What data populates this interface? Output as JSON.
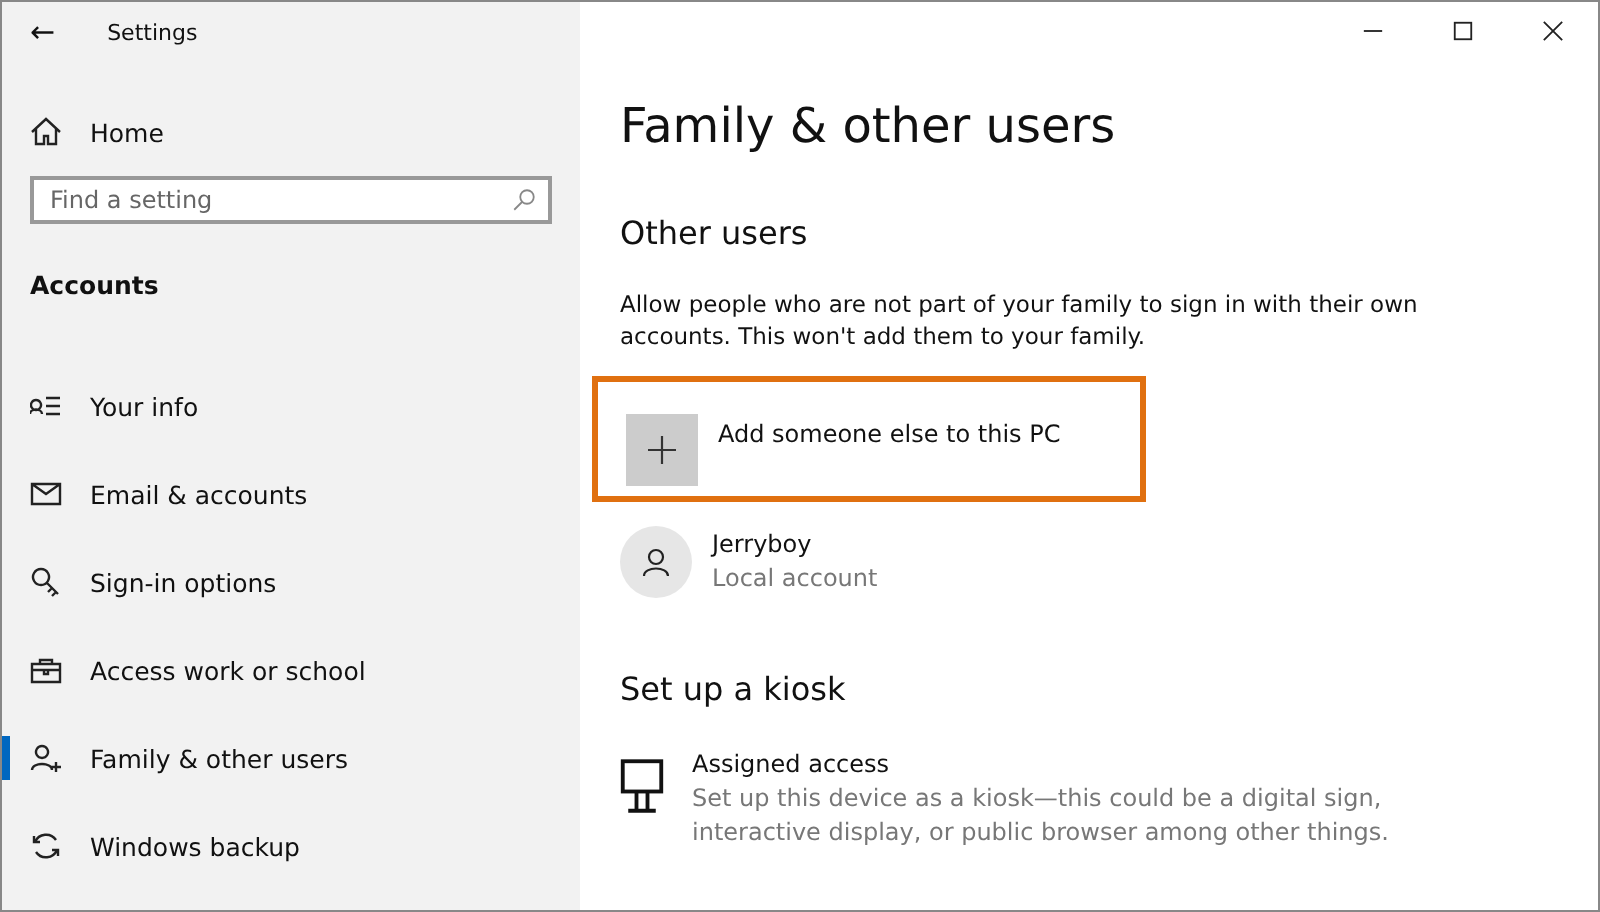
{
  "window": {
    "title": "Settings",
    "back": "←"
  },
  "sidebar": {
    "home": "Home",
    "search": {
      "placeholder": "Find a setting"
    },
    "section": "Accounts",
    "items": [
      {
        "label": "Your info",
        "kind": "info",
        "selected": false
      },
      {
        "label": "Email & accounts",
        "kind": "mail",
        "selected": false
      },
      {
        "label": "Sign-in options",
        "kind": "key",
        "selected": false
      },
      {
        "label": "Access work or school",
        "kind": "briefcase",
        "selected": false
      },
      {
        "label": "Family & other users",
        "kind": "person-add",
        "selected": true
      },
      {
        "label": "Windows backup",
        "kind": "sync",
        "selected": false
      }
    ]
  },
  "main": {
    "title": "Family & other users",
    "other_users": {
      "heading": "Other users",
      "description": "Allow people who are not part of your family to sign in with their own accounts. This won't add them to your family.",
      "add_button": {
        "label": "Add someone else to this PC",
        "highlighted": true
      },
      "users": [
        {
          "name": "Jerryboy",
          "type": "Local account"
        }
      ]
    },
    "kiosk": {
      "heading": "Set up a kiosk",
      "items": [
        {
          "title": "Assigned access",
          "description": "Set up this device as a kiosk—this could be a digital sign, interactive display, or public browser among other things."
        }
      ]
    }
  }
}
